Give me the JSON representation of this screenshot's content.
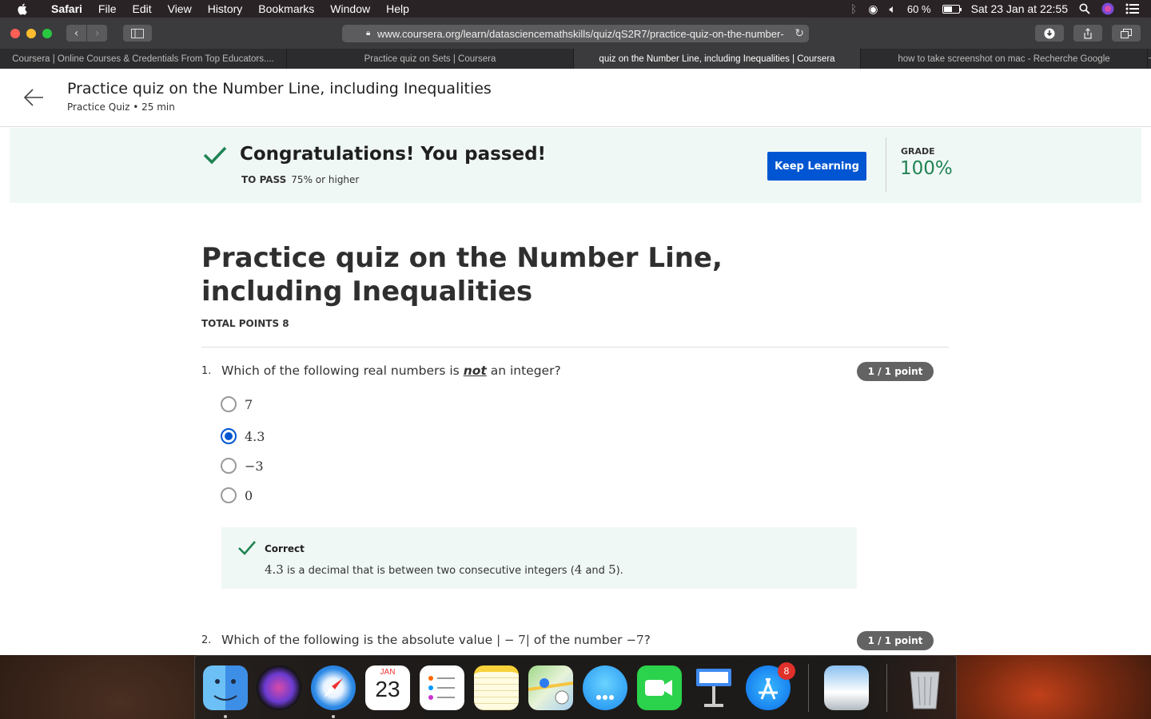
{
  "menubar": {
    "app_name": "Safari",
    "items": [
      "File",
      "Edit",
      "View",
      "History",
      "Bookmarks",
      "Window",
      "Help"
    ],
    "battery_percent": "60 %",
    "battery_level": 0.6,
    "datetime": "Sat 23 Jan at  22:55"
  },
  "browser": {
    "url": "www.coursera.org/learn/datasciencemathskills/quiz/qS2R7/practice-quiz-on-the-number-",
    "tabs": [
      {
        "label": "Coursera | Online Courses & Credentials From Top Educators....",
        "active": false
      },
      {
        "label": "Practice quiz on Sets | Coursera",
        "active": false
      },
      {
        "label": "quiz on the Number Line, including Inequalities | Coursera",
        "active": true
      },
      {
        "label": "how to take screenshot on mac - Recherche Google",
        "active": false
      }
    ],
    "new_tab": "+"
  },
  "header": {
    "title": "Practice quiz on the Number Line, including Inequalities",
    "subtitle": "Practice Quiz • 25 min"
  },
  "banner": {
    "message": "Congratulations! You passed!",
    "to_pass_label": "TO PASS",
    "to_pass_value": "75% or higher",
    "button": "Keep Learning",
    "grade_label": "GRADE",
    "grade_value": "100%",
    "grade_color": "#1f8354"
  },
  "quiz": {
    "title": "Practice quiz on the Number Line, including Inequalities",
    "total_points": "TOTAL POINTS 8",
    "questions": [
      {
        "number": "1.",
        "text_before": "Which of the following real numbers is",
        "emphasis": "not",
        "text_after": "an integer?",
        "points": "1 / 1 point",
        "options": [
          {
            "label": "7",
            "selected": false
          },
          {
            "label": "4.3",
            "selected": true
          },
          {
            "label": "−3",
            "selected": false
          },
          {
            "label": "0",
            "selected": false
          }
        ],
        "feedback": {
          "status": "Correct",
          "value": "4.3",
          "text1": "is a decimal that is between two consecutive integers (",
          "a": "4",
          "and": "and",
          "b": "5",
          "end": ")."
        }
      },
      {
        "number": "2.",
        "text_before": "Which of the following is the absolute value",
        "math": "| − 7|",
        "text_mid": "of the number",
        "math2": "−7",
        "text_after": "?",
        "points": "1 / 1 point"
      }
    ]
  },
  "dock": {
    "calendar_month": "JAN",
    "calendar_day": "23",
    "appstore_badge": "8",
    "apps": [
      "finder-icon",
      "siri-icon",
      "safari-icon",
      "calendar-icon",
      "reminders-icon",
      "notes-icon",
      "maps-icon",
      "messages-icon",
      "facetime-icon",
      "keynote-icon",
      "app-store-icon",
      "preview-icon",
      "trash-icon"
    ]
  },
  "colors": {
    "accent_blue": "#0056d2",
    "success_green": "#1f8354",
    "banner_bg": "#f0f8f5"
  }
}
